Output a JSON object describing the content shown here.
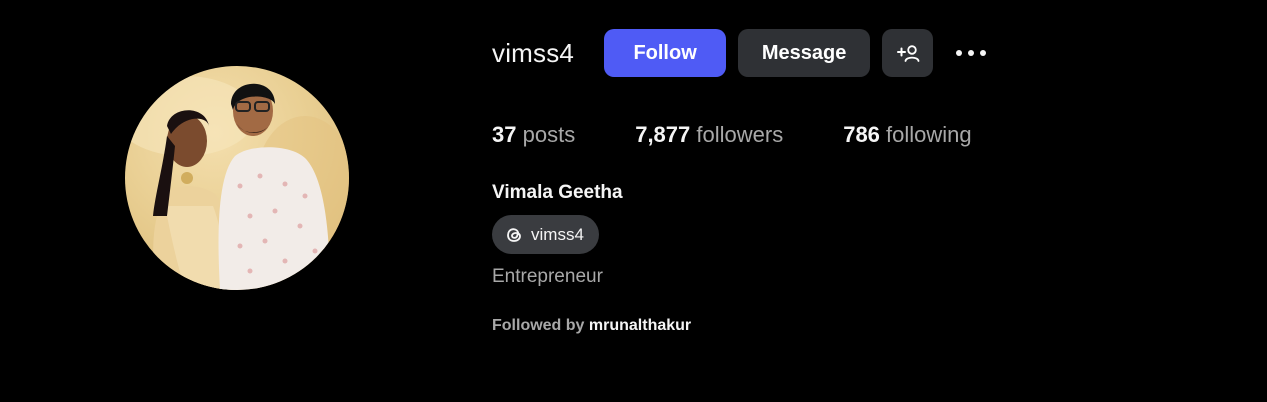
{
  "profile": {
    "username": "vimss4",
    "full_name": "Vimala Geetha",
    "bio": "Entrepreneur",
    "threads_handle": "vimss4"
  },
  "actions": {
    "follow_label": "Follow",
    "message_label": "Message",
    "add_user_icon": "add-person-icon",
    "more_icon": "more-horizontal-icon"
  },
  "stats": {
    "posts_count": "37",
    "posts_label": "posts",
    "followers_count": "7,877",
    "followers_label": "followers",
    "following_count": "786",
    "following_label": "following"
  },
  "followed_by": {
    "prefix": "Followed by",
    "user": "mrunalthakur"
  },
  "colors": {
    "background": "#000000",
    "follow_button": "#4f5bf5",
    "secondary_button": "#2f3135",
    "muted_text": "#a8a8a8",
    "primary_text": "#f5f5f5"
  }
}
